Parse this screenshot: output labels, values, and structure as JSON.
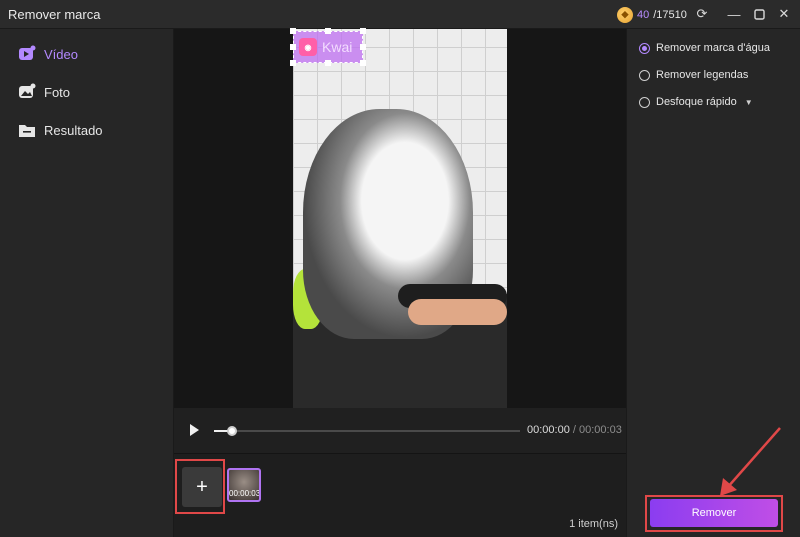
{
  "window": {
    "title": "Remover marca"
  },
  "credits": {
    "used": "40",
    "total": "/17510"
  },
  "sidebar": {
    "items": [
      {
        "label": "Vídeo",
        "icon": "video-icon",
        "active": true
      },
      {
        "label": "Foto",
        "icon": "photo-icon",
        "active": false
      },
      {
        "label": "Resultado",
        "icon": "folder-icon",
        "active": false
      }
    ]
  },
  "preview": {
    "watermark_text": "Kwai"
  },
  "player": {
    "current_time": "00:00:00",
    "separator": "/",
    "total_time": "00:00:03",
    "progress": 0.06
  },
  "media": {
    "clip_duration": "00:00:03",
    "item_count": "1 item(ns)"
  },
  "options": {
    "items": [
      {
        "label": "Remover marca d'água",
        "selected": true
      },
      {
        "label": "Remover legendas",
        "selected": false
      },
      {
        "label": "Desfoque rápido",
        "selected": false
      }
    ]
  },
  "actions": {
    "remove_label": "Remover"
  },
  "colors": {
    "accent": "#b389ff",
    "highlight": "#e04848",
    "button_gradient_start": "#8b3df0",
    "button_gradient_end": "#c04ee6"
  }
}
